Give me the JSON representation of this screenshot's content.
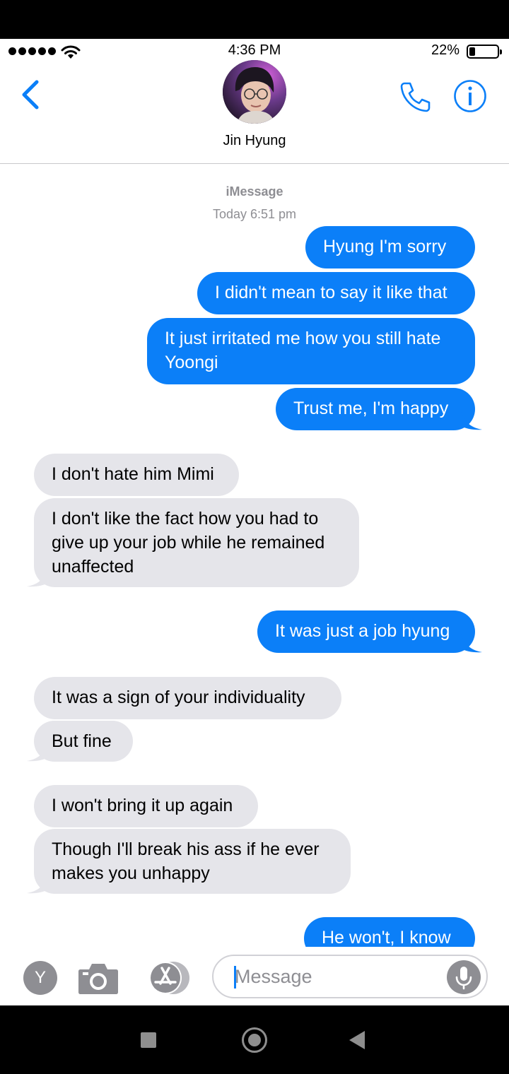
{
  "status_bar": {
    "time": "4:36 PM",
    "battery_percent": "22%",
    "battery_level": 0.22
  },
  "header": {
    "contact_name": "Jin Hyung",
    "icons": [
      "chevron-left-icon",
      "phone-icon",
      "info-icon"
    ]
  },
  "conversation": {
    "service_label": "iMessage",
    "timestamp": "Today 6:51 pm",
    "messages": [
      {
        "sender": "me",
        "text": "Hyung I'm sorry"
      },
      {
        "sender": "me",
        "text": "I didn't mean to say it like that"
      },
      {
        "sender": "me",
        "text": "It just irritated me how you still hate Yoongi"
      },
      {
        "sender": "me",
        "text": "Trust me, I'm happy"
      },
      {
        "sender": "them",
        "text": "I don't hate him Mimi"
      },
      {
        "sender": "them",
        "text": "I don't like the fact how you had to give up your job while he remained unaffected"
      },
      {
        "sender": "me",
        "text": "It was just a job hyung"
      },
      {
        "sender": "them",
        "text": "It was a sign of your individuality"
      },
      {
        "sender": "them",
        "text": "But fine"
      },
      {
        "sender": "them",
        "text": "I won't bring it up again"
      },
      {
        "sender": "them",
        "text": "Though I'll break his ass if he ever makes you unhappy"
      },
      {
        "sender": "me",
        "text": "He won't, I know"
      }
    ]
  },
  "composer": {
    "app_button_label": "Y",
    "placeholder": "Message",
    "value": ""
  },
  "colors": {
    "accent": "#0b7ff8",
    "incoming_bubble": "#e5e5ea",
    "muted": "#8e8e93"
  }
}
